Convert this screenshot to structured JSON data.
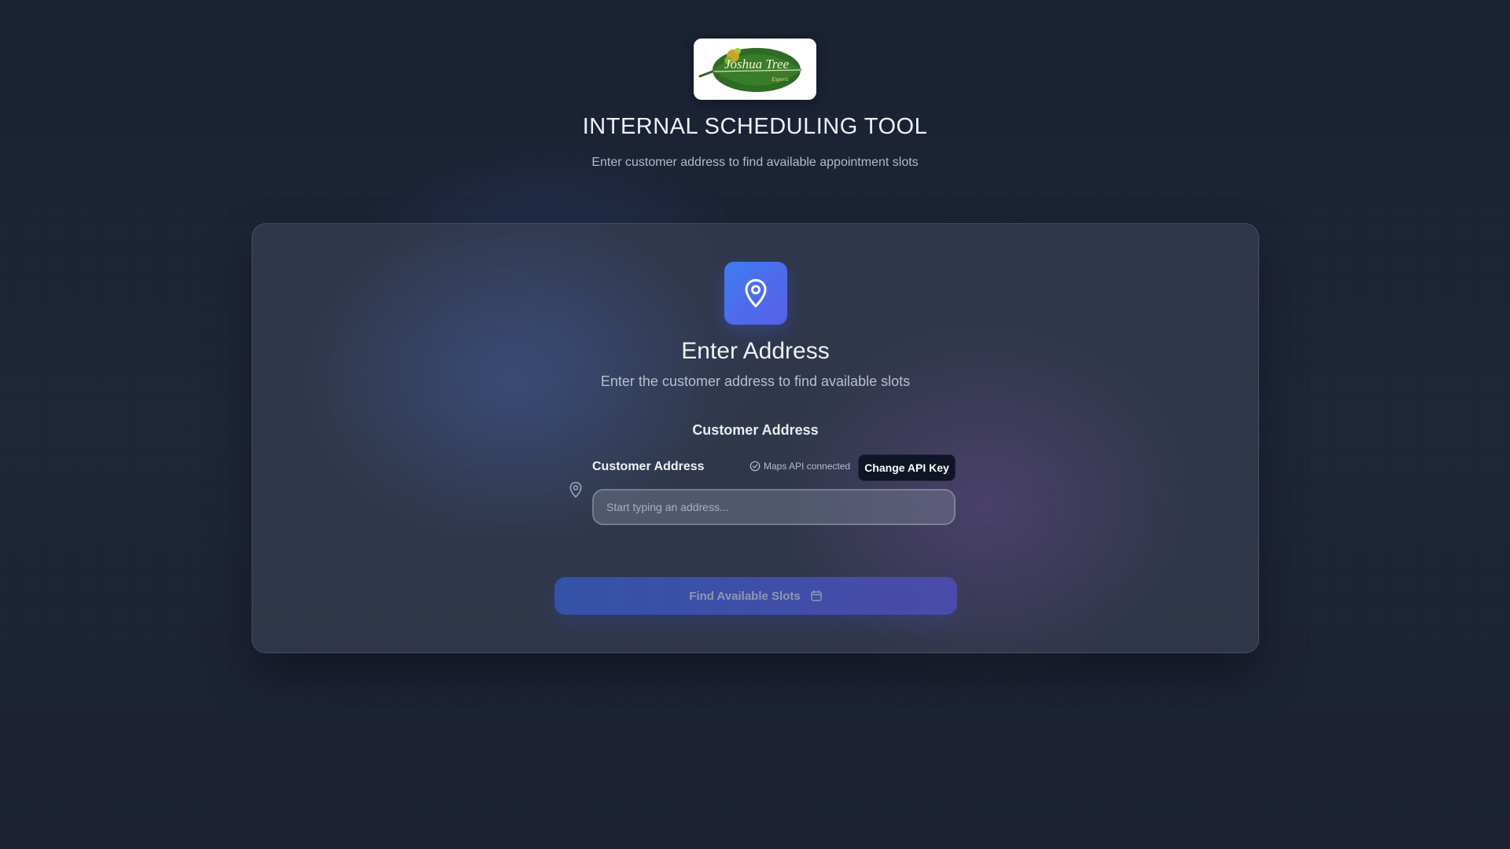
{
  "header": {
    "logo": {
      "brand_name": "Joshua Tree",
      "tagline": "Experts",
      "icon": "leaf-logo"
    },
    "title": "INTERNAL SCHEDULING TOOL",
    "subtitle": "Enter customer address to find available appointment slots"
  },
  "card": {
    "icon": "map-pin-icon",
    "title": "Enter Address",
    "subtitle": "Enter the customer address to find available slots",
    "section_label": "Customer Address",
    "address_field": {
      "label": "Customer Address",
      "placeholder": "Start typing an address...",
      "value": "",
      "icon": "map-pin-icon"
    },
    "api_status": {
      "text": "Maps API connected",
      "icon": "check-circle-icon"
    },
    "change_api_key_label": "Change API Key",
    "find_button": {
      "label": "Find Available Slots",
      "icon": "calendar-icon",
      "disabled": true
    }
  },
  "colors": {
    "background": "#1e2638",
    "accent": "#4f6ef0",
    "accent_secondary": "#5a5ee8",
    "dark_button": "#0f1526"
  }
}
